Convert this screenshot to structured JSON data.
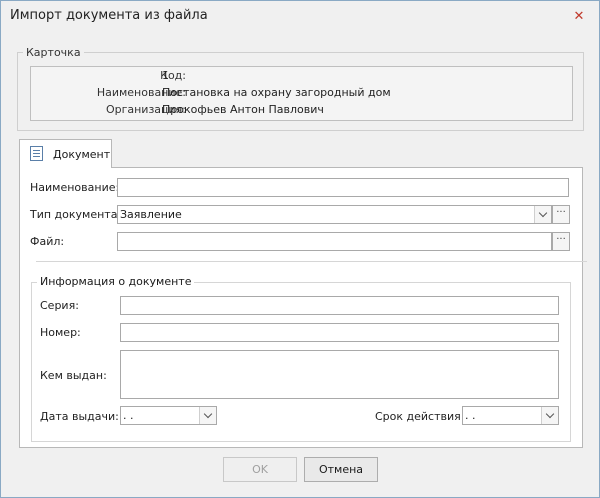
{
  "window": {
    "title": "Импорт документа из файла"
  },
  "card": {
    "legend": "Карточка",
    "rows": [
      {
        "key": "Код:",
        "value": "1"
      },
      {
        "key": "Наименование:",
        "value": "Постановка на охрану загородный дом"
      },
      {
        "key": "Организация:",
        "value": "Прокофьев Антон Павлович"
      }
    ]
  },
  "tabs": [
    {
      "label": "Документ",
      "icon": "document-icon"
    }
  ],
  "form": {
    "name_label": "Наименование:",
    "name_value": "",
    "type_label": "Тип документа:",
    "type_value": "Заявление",
    "file_label": "Файл:",
    "file_value": "",
    "browse_label": "···"
  },
  "doc_info": {
    "legend": "Информация о документе",
    "series_label": "Серия:",
    "number_label": "Номер:",
    "issued_by_label": "Кем выдан:",
    "issue_date_label": "Дата выдачи:",
    "issue_date_value": " .  .",
    "validity_label": "Срок действия:",
    "validity_value": " .  ."
  },
  "buttons": {
    "ok": "OK",
    "cancel": "Отмена"
  }
}
